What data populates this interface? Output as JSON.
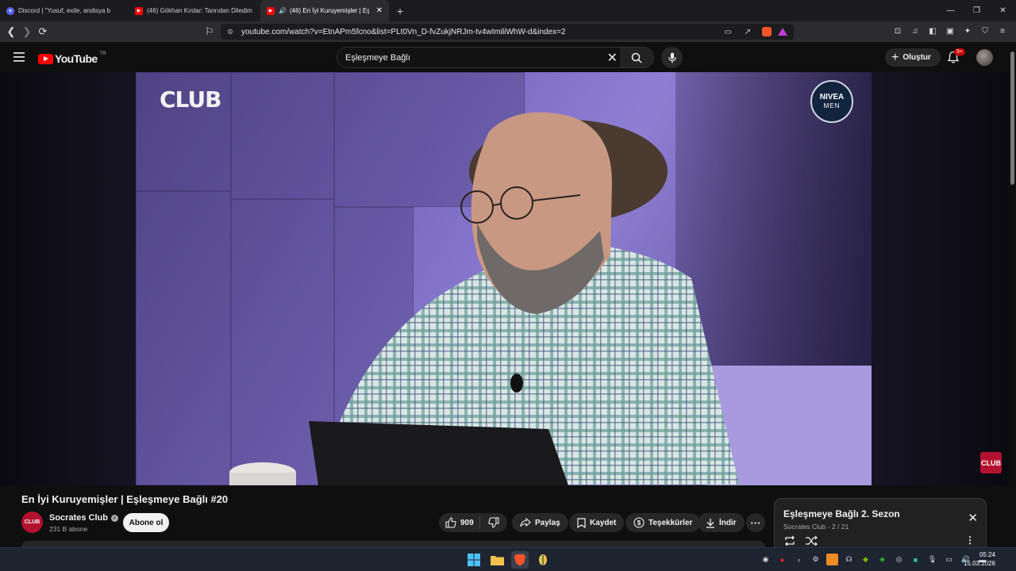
{
  "browser": {
    "tabs": [
      {
        "label": "Discord | \"Yusuf, exile, andisya b",
        "active": false,
        "icon": "discord-icon"
      },
      {
        "label": "(46) Gökhan Kırdar: Tanrıdan Diledim",
        "active": false,
        "icon": "youtube-icon"
      },
      {
        "label": "(46) En İyi Kuruyemişler | Eşle",
        "active": true,
        "icon": "youtube-icon"
      }
    ],
    "new_tab": "+",
    "url": "youtube.com/watch?v=EtnAPm5fcno&list=PLt0Vn_D-fvZukjNRJm-tv4wImiliWhW-d&index=2"
  },
  "youtube": {
    "logo_text": "YouTube",
    "country_code": "TR",
    "search_value": "Eşleşmeye Bağlı",
    "create_label": "Oluştur",
    "notification_badge": "9+"
  },
  "video": {
    "channel_watermark": "CLUB",
    "sponsor_line1": "NIVEA",
    "sponsor_line2": "MEN",
    "corner_badge": "CLUB",
    "title": "En İyi Kuruyemişler | Eşleşmeye Bağlı #20",
    "channel_name": "Socrates Club",
    "channel_avatar_text": "CLUB",
    "subscribers": "231 B abone",
    "subscribe_label": "Abone ol",
    "likes": "909",
    "share_label": "Paylaş",
    "save_label": "Kaydet",
    "thanks_label": "Teşekkürler",
    "download_label": "İndir"
  },
  "playlist": {
    "title": "Eşleşmeye Bağlı 2. Sezon",
    "subtitle": "Socrates Club - 2 / 21"
  },
  "taskbar": {
    "time": "05:24",
    "date": "15.03.2026"
  },
  "colors": {
    "youtube_red": "#ff0000",
    "background": "#0f0f0f",
    "channel_brand": "#b3122e"
  }
}
